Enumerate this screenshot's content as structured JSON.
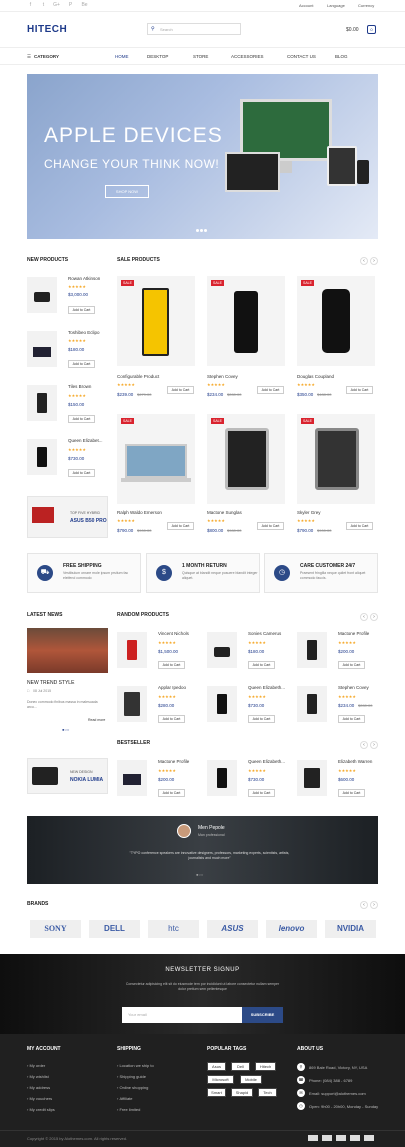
{
  "topbar": {
    "social": [
      "f",
      "t",
      "G+",
      "P",
      "Be"
    ],
    "account": "Account",
    "language": "Language",
    "currency": "Currency"
  },
  "header": {
    "logo": "HITECH",
    "search_placeholder": "Search",
    "cart_total": "$0.00",
    "cart_count": "0"
  },
  "nav": {
    "category": "CATEGORY",
    "items": [
      "HOME",
      "DESKTOP",
      "STORE",
      "ACCESSORIES",
      "CONTACT US",
      "BLOG"
    ]
  },
  "hero": {
    "title": "APPLE DEVICES",
    "subtitle": "CHANGE YOUR THINK NOW!",
    "button": "SHOP NOW"
  },
  "new_products": {
    "title": "NEW PRODUCTS",
    "items": [
      {
        "name": "Rowan Atkinson",
        "price": "$3,000.00",
        "add": "Add to Cart"
      },
      {
        "name": "Toshibeo Eclipo",
        "price": "$180.00",
        "add": "Add to Cart"
      },
      {
        "name": "Tiles Brown",
        "price": "$150.00",
        "add": "Add to Cart"
      },
      {
        "name": "Queen Elizabet...",
        "price": "$730.00",
        "add": "Add to Cart"
      }
    ],
    "banner": {
      "line1": "TOP FIVE HYBRID",
      "line2": "ASUS B50 PRO"
    }
  },
  "sale_products": {
    "title": "SALE PRODUCTS",
    "badge": "SALE",
    "items": [
      {
        "name": "Configurable Product",
        "price": "$239.00",
        "old": "$679.00",
        "add": "Add to Cart"
      },
      {
        "name": "Stephen Covey",
        "price": "$234.00",
        "old": "$280.00",
        "add": "Add to Cart"
      },
      {
        "name": "Douglas Coupland",
        "price": "$350.00",
        "old": "$488.00",
        "add": "Add to Cart"
      },
      {
        "name": "Ralph Waldo Emerson",
        "price": "$790.00",
        "old": "$900.00",
        "add": "Add to Cart"
      },
      {
        "name": "Mactone Sunglas",
        "price": "$800.00",
        "old": "$980.00",
        "add": "Add to Cart"
      },
      {
        "name": "Skyler Grey",
        "price": "$790.00",
        "old": "$900.00",
        "add": "Add to Cart"
      }
    ]
  },
  "features": [
    {
      "title": "FREE SHIPPING",
      "desc": "Vestibulum ornare mole ipsum prsitum fac eleifend commodo",
      "icon": "truck-icon"
    },
    {
      "title": "1 MONTH RETURN",
      "desc": "Quisque at blandit neque posuere blandit integer aliquet.",
      "icon": "dollar-icon"
    },
    {
      "title": "CARE CUSTOMER 24/7",
      "desc": "Praesent fringilla neque quilet front aliquet commodo faucis.",
      "icon": "clock-icon"
    }
  ],
  "latest_news": {
    "title": "LATEST NEWS",
    "post_title": "NEW TREND STYLE",
    "date": "08 Jul 2015",
    "excerpt": "Donec commodo finibus massa in malesuada arcu...",
    "read_more": "Read more"
  },
  "random_products": {
    "title": "RANDOM PRODUCTS",
    "items": [
      {
        "name": "Vincent Nichols",
        "price": "$1,500.00",
        "add": "Add to Cart"
      },
      {
        "name": "Sonies Camerus",
        "price": "$180.00",
        "add": "Add to Cart"
      },
      {
        "name": "Mactone Profile",
        "price": "$200.00",
        "add": "Add to Cart"
      },
      {
        "name": "Applar Ipedoo",
        "price": "$280.00",
        "add": "Add to Cart"
      },
      {
        "name": "Queen Elizabeth...",
        "price": "$730.00",
        "add": "Add to Cart"
      },
      {
        "name": "Stephen Covey",
        "price": "$234.00",
        "old": "$280.00",
        "add": "Add to Cart"
      }
    ]
  },
  "bestseller": {
    "title": "BESTSELLER",
    "banner": {
      "line1": "NEW DESIGN",
      "line2": "NOKIA LUMIA"
    },
    "items": [
      {
        "name": "Mactone Profile",
        "price": "$200.00",
        "add": "Add to Cart"
      },
      {
        "name": "Queen Elizabeth...",
        "price": "$730.00",
        "add": "Add to Cart"
      },
      {
        "name": "Elizabeth Warren",
        "price": "$600.00",
        "add": "Add to Cart"
      }
    ]
  },
  "testimonial": {
    "name": "Men Pepole",
    "role": "Man professional",
    "quote": "\"TYPO conference speakers are innovative designers, professors, marketing experts, scientists, artists, journalists and much more\""
  },
  "brands": {
    "title": "BRANDS",
    "items": [
      "SONY",
      "DELL",
      "htc",
      "ASUS",
      "lenovo",
      "NVIDIA"
    ]
  },
  "newsletter": {
    "title": "NEWSLETTER SIGNUP",
    "desc": "Consectetur adipisicing elit sit do eiusmode tem por incididunt ut labore consectetur nullam semper dolor pretium sem pellentesque",
    "placeholder": "Your email",
    "button": "SUBSCRIBE"
  },
  "footer": {
    "my_account": {
      "title": "MY ACCOUNT",
      "items": [
        "My order",
        "My wishlist",
        "My address",
        "My vouchers",
        "My credit slips"
      ]
    },
    "shipping": {
      "title": "SHIPPING",
      "items": [
        "Location we ship to",
        "Shipping guide",
        "Online shopping",
        "Affiliate",
        "Free limited"
      ]
    },
    "tags": {
      "title": "POPULAR TAGS",
      "items": [
        "Asus",
        "Dell",
        "Hitech",
        "Microsoft",
        "Mobile",
        "Smart",
        "Shapid",
        "Tech"
      ]
    },
    "about": {
      "title": "ABOUT US",
      "items": [
        "869 Bale Road, Victory, NY, USA",
        "Phone: (084) 388 - 6789",
        "Email: support@alothemes.com",
        "Open: 9h00 - 20h00, Monday - Sunday"
      ]
    },
    "copyright": "Copyright © 2015 by Alothemes.com. All rights reserved."
  }
}
